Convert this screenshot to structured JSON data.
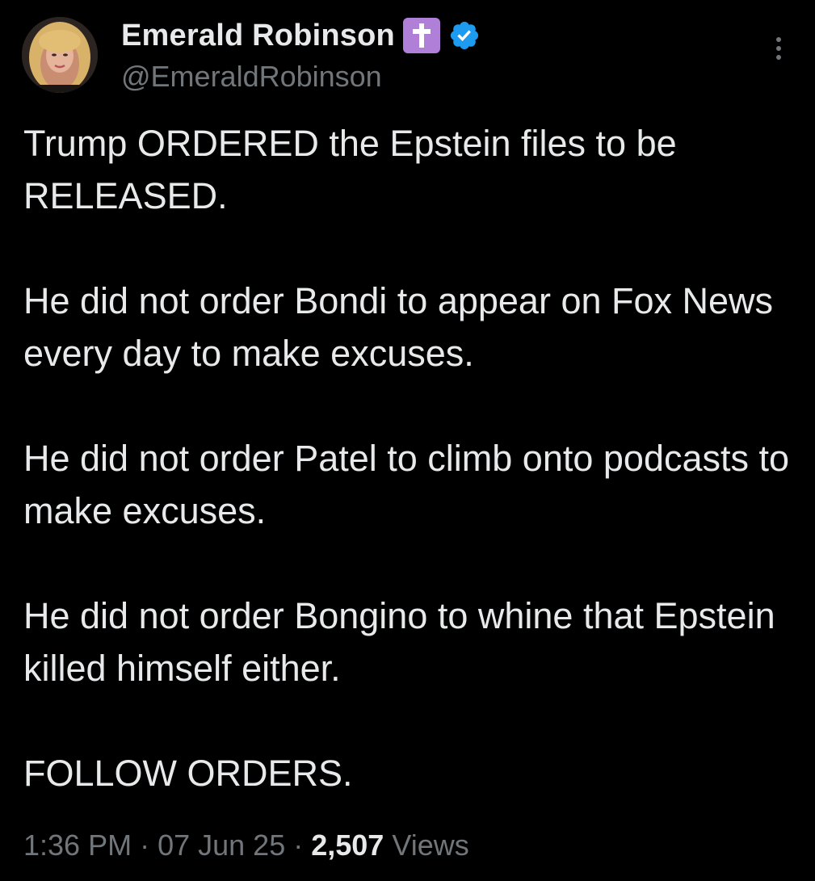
{
  "author": {
    "display_name": "Emerald Robinson",
    "handle": "@EmeraldRobinson",
    "emoji_icon": "latin-cross-emoji",
    "verified_icon": "verified-badge-icon",
    "verified_color": "#1d9bf0"
  },
  "tweet": {
    "paragraphs": [
      "Trump ORDERED the Epstein files to be RELEASED.",
      "He did not order Bondi to appear on Fox News every day to make excuses.",
      "He did not order Patel to climb onto podcasts to make excuses.",
      "He did not order Bongino to whine that Epstein killed himself either.",
      "FOLLOW ORDERS."
    ]
  },
  "meta": {
    "time": "1:36 PM",
    "separator": " · ",
    "date": "07 Jun 25",
    "views_count": "2,507",
    "views_label": "Views"
  },
  "colors": {
    "background": "#000000",
    "primary_text": "#e7e9ea",
    "secondary_text": "#71767b",
    "emoji_bg": "#b07fd8"
  },
  "icons": {
    "more": "more-options-icon"
  }
}
